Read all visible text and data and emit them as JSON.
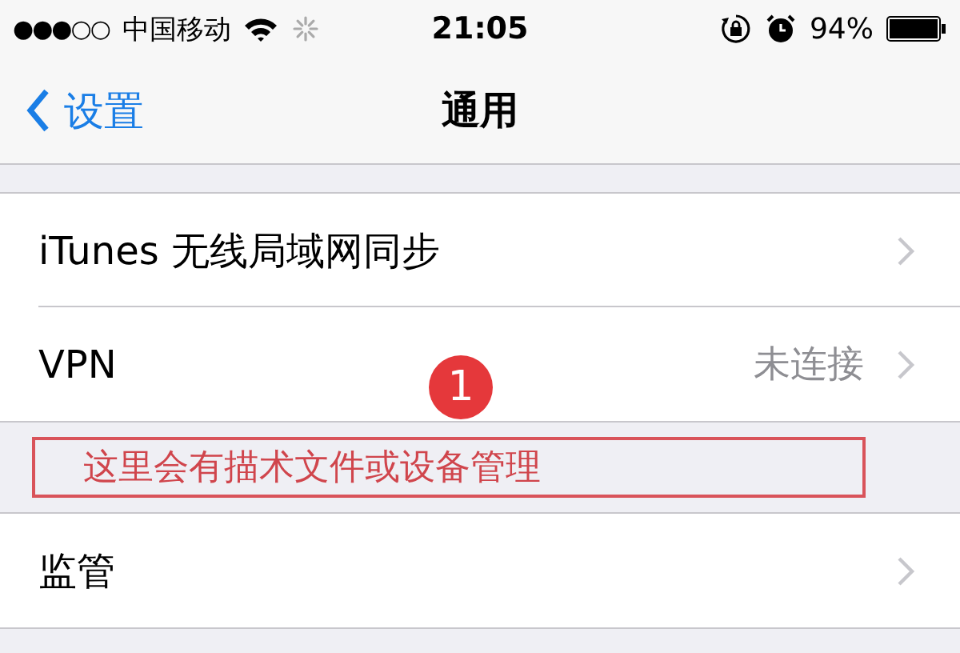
{
  "status_bar": {
    "signal": "●●●○○",
    "carrier": "中国移动",
    "time": "21:05",
    "battery_percent": "94%"
  },
  "nav_bar": {
    "back_label": "设置",
    "title": "通用"
  },
  "sections": [
    {
      "rows": [
        {
          "label": "iTunes 无线局域网同步"
        },
        {
          "label": "VPN",
          "detail": "未连接"
        }
      ]
    },
    {
      "rows": [
        {
          "label": "监管"
        }
      ]
    }
  ],
  "annotation": {
    "badge": "1",
    "note": "这里会有描术文件或设备管理"
  }
}
